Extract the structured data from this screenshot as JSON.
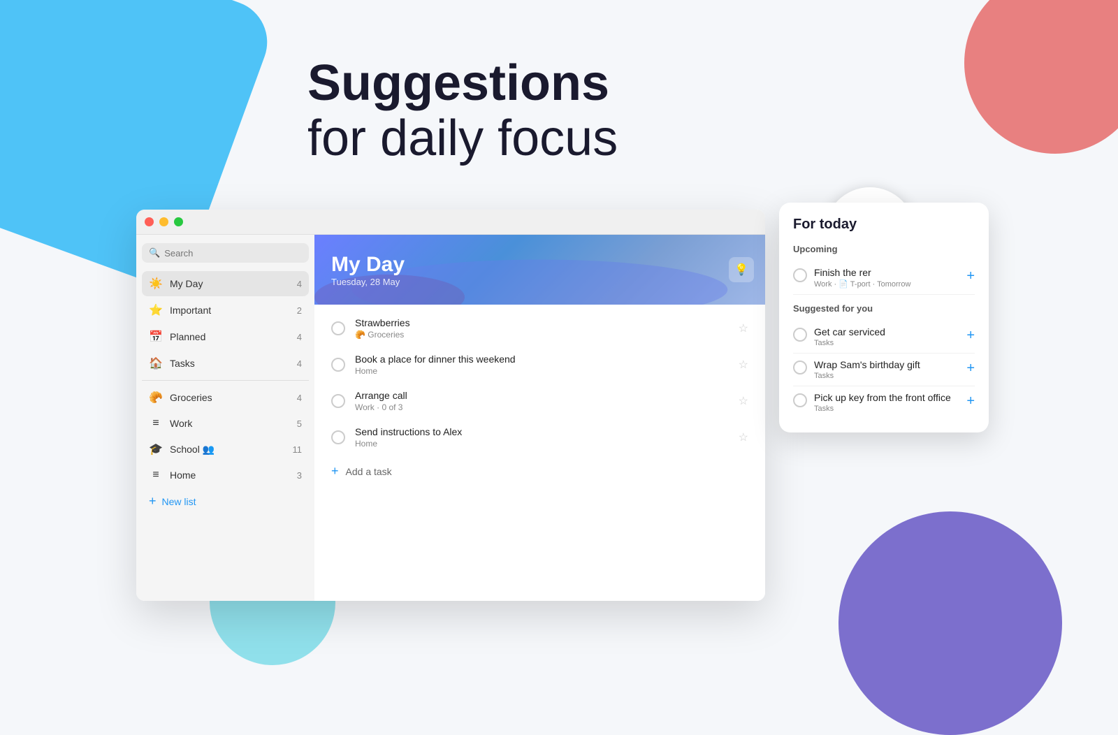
{
  "page": {
    "heading_main": "Suggestions",
    "heading_sub": "for daily focus"
  },
  "titlebar": {
    "buttons": [
      "close",
      "minimize",
      "maximize"
    ]
  },
  "sidebar": {
    "search_placeholder": "Search",
    "nav_items": [
      {
        "id": "my-day",
        "icon": "☀️",
        "label": "My Day",
        "count": "4",
        "active": true
      },
      {
        "id": "important",
        "icon": "⭐",
        "label": "Important",
        "count": "2",
        "active": false
      },
      {
        "id": "planned",
        "icon": "📅",
        "label": "Planned",
        "count": "4",
        "active": false
      },
      {
        "id": "tasks",
        "icon": "🏠",
        "label": "Tasks",
        "count": "4",
        "active": false
      }
    ],
    "list_items": [
      {
        "id": "groceries",
        "icon": "🥐",
        "label": "Groceries",
        "count": "4"
      },
      {
        "id": "work",
        "icon": "≡",
        "label": "Work",
        "count": "5"
      },
      {
        "id": "school",
        "icon": "🎓",
        "label": "School 👥",
        "count": "11"
      },
      {
        "id": "home",
        "icon": "≡",
        "label": "Home",
        "count": "3"
      }
    ],
    "new_list_label": "New list"
  },
  "my_day": {
    "title": "My Day",
    "subtitle": "Tuesday, 28 May",
    "suggestion_btn": "💡"
  },
  "tasks": [
    {
      "id": "strawberries",
      "title": "Strawberries",
      "meta": "🥐 Groceries"
    },
    {
      "id": "dinner",
      "title": "Book a place for dinner this weekend",
      "meta": "Home"
    },
    {
      "id": "call",
      "title": "Arrange call",
      "meta": "Work · 0 of 3"
    },
    {
      "id": "alex",
      "title": "Send instructions to Alex",
      "meta": "Home"
    }
  ],
  "add_task_label": "Add a task",
  "for_today": {
    "title": "For today",
    "upcoming_label": "Upcoming",
    "upcoming_tasks": [
      {
        "id": "finish-report",
        "title": "Finish the rer",
        "meta": "Work · 📄 T-port · Tomorrow"
      }
    ],
    "suggested_label": "Suggested for you",
    "suggested_tasks": [
      {
        "id": "car-service",
        "title": "Get car serviced",
        "list": "Tasks"
      },
      {
        "id": "birthday-gift",
        "title": "Wrap Sam's birthday gift",
        "list": "Tasks"
      },
      {
        "id": "pick-up-key",
        "title": "Pick up key from the front office",
        "list": "Tasks"
      }
    ]
  },
  "magnifier": {
    "task": "Finish the rer",
    "meta": "Work · 📄 T-port",
    "date": "Tomorrow"
  },
  "colors": {
    "accent_blue": "#2196f3",
    "sidebar_active": "#e5e5e5",
    "header_gradient_start": "#6b7fff",
    "header_gradient_end": "#4a90d9",
    "bg_blue_shape": "#4fc3f7",
    "bg_red_shape": "#e88080",
    "bg_purple_shape": "#7c6fcd"
  }
}
